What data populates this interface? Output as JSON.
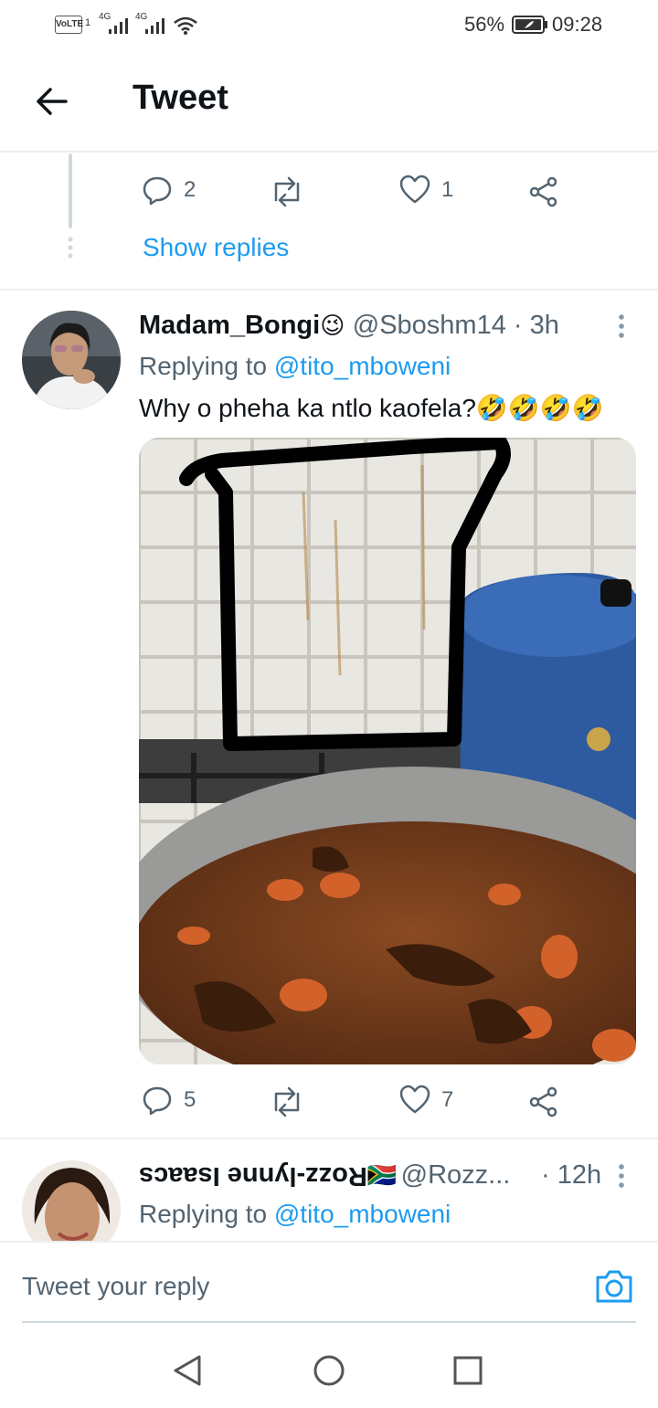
{
  "status_bar": {
    "volte": "VoLTE",
    "sim1": "1",
    "net1": "4G",
    "net2": "4G",
    "battery": "56%",
    "time": "09:28"
  },
  "header": {
    "title": "Tweet"
  },
  "prev_tweet": {
    "reply_count": "2",
    "like_count": "1",
    "show_replies": "Show replies"
  },
  "tweet": {
    "name": "Madam_Bongi",
    "name_emoji": "😉",
    "handle_time": "@Sboshm14 · 3h",
    "replying_prefix": "Replying to ",
    "replying_to": "@tito_mboweni",
    "text": "Why o pheha ka ntlo kaofela?",
    "text_emoji": "🤣🤣🤣🤣",
    "reply_count": "5",
    "like_count": "7"
  },
  "next_tweet": {
    "name": "Rozz-lynne Isaacs",
    "flag": "🇿🇦",
    "handle": "@Rozz...",
    "time": "· 12h",
    "replying_prefix": "Replying to ",
    "replying_to": "@tito_mboweni"
  },
  "reply_box": {
    "placeholder": "Tweet your reply"
  },
  "colors": {
    "accent": "#1d9bf0",
    "muted": "#536471",
    "divider": "#eceff1"
  }
}
